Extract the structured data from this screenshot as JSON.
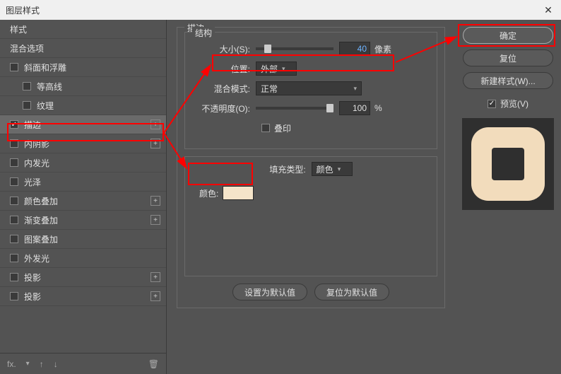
{
  "title": "图层样式",
  "sidebar": {
    "styles_header": "样式",
    "blending_options": "混合选项",
    "items": [
      {
        "label": "斜面和浮雕",
        "checked": false,
        "plus": false,
        "sub": false
      },
      {
        "label": "等高线",
        "checked": false,
        "plus": false,
        "sub": true
      },
      {
        "label": "纹理",
        "checked": false,
        "plus": false,
        "sub": true
      },
      {
        "label": "描边",
        "checked": true,
        "plus": true,
        "sub": false,
        "selected": true
      },
      {
        "label": "内阴影",
        "checked": false,
        "plus": true,
        "sub": false
      },
      {
        "label": "内发光",
        "checked": false,
        "plus": false,
        "sub": false
      },
      {
        "label": "光泽",
        "checked": false,
        "plus": false,
        "sub": false
      },
      {
        "label": "颜色叠加",
        "checked": false,
        "plus": true,
        "sub": false
      },
      {
        "label": "渐变叠加",
        "checked": false,
        "plus": true,
        "sub": false
      },
      {
        "label": "图案叠加",
        "checked": false,
        "plus": false,
        "sub": false
      },
      {
        "label": "外发光",
        "checked": false,
        "plus": false,
        "sub": false
      },
      {
        "label": "投影",
        "checked": false,
        "plus": true,
        "sub": false
      },
      {
        "label": "投影",
        "checked": false,
        "plus": true,
        "sub": false
      }
    ]
  },
  "main": {
    "panel_title": "描边",
    "structure_title": "结构",
    "size_label": "大小(S):",
    "size_value": "40",
    "size_unit": "像素",
    "position_label": "位置:",
    "position_value": "外部",
    "blend_label": "混合模式:",
    "blend_value": "正常",
    "opacity_label": "不透明度(O):",
    "opacity_value": "100",
    "opacity_unit": "%",
    "overprint_label": "叠印",
    "filltype_label": "填充类型:",
    "filltype_value": "颜色",
    "color_label": "颜色:",
    "color_value": "#f5e4c9",
    "btn_default": "设置为默认值",
    "btn_reset": "复位为默认值"
  },
  "right": {
    "ok": "确定",
    "cancel": "复位",
    "newstyle": "新建样式(W)...",
    "preview": "预览(V)",
    "preview_checked": true
  }
}
